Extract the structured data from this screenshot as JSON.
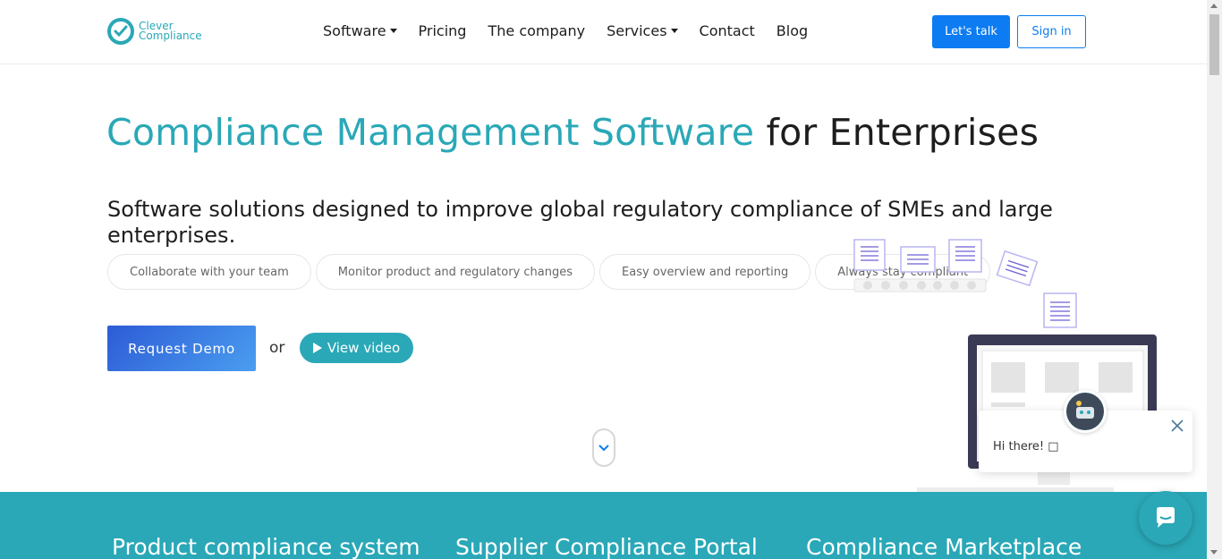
{
  "header": {
    "logo": {
      "line1": "Clever",
      "line2": "Compliance"
    },
    "nav": [
      {
        "label": "Software",
        "dropdown": true
      },
      {
        "label": "Pricing",
        "dropdown": false
      },
      {
        "label": "The company",
        "dropdown": false
      },
      {
        "label": "Services",
        "dropdown": true
      },
      {
        "label": "Contact",
        "dropdown": false
      },
      {
        "label": "Blog",
        "dropdown": false
      }
    ],
    "cta_label": "Let's talk",
    "signin_label": "Sign in"
  },
  "hero": {
    "title_accent": "Compliance Management Software",
    "title_rest": "for Enterprises",
    "subtitle": "Software solutions designed to improve global regulatory compliance of SMEs and large enterprises.",
    "chips": [
      "Collaborate with your team",
      "Monitor product and regulatory changes",
      "Easy overview and reporting",
      "Always stay compliant"
    ],
    "demo_label": "Request Demo",
    "or_text": "or",
    "video_label": "View video"
  },
  "band": {
    "titles": [
      "Product compliance system",
      "Supplier Compliance Portal",
      "Compliance Marketplace"
    ]
  },
  "chat": {
    "greeting": "Hi there! □"
  },
  "colors": {
    "brand_teal": "#2aa8b7",
    "primary_blue": "#0d7cf2",
    "text_dark": "#1d1d1f"
  },
  "icons": [
    "logo-check-icon",
    "caret-down-icon",
    "play-icon",
    "chevron-down-icon",
    "close-icon",
    "chat-icon"
  ]
}
